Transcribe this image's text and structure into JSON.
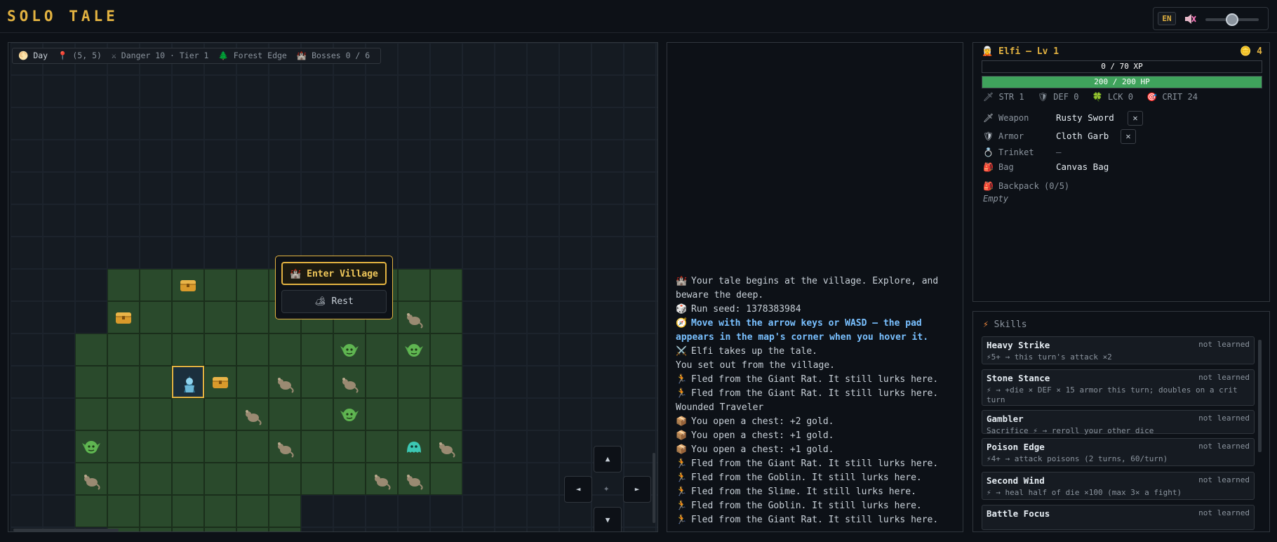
{
  "app": {
    "title": "SOLO TALE",
    "language": "EN",
    "volume": 0.45
  },
  "map": {
    "status": {
      "time": "Day",
      "position": "(5, 5)",
      "danger": "Danger 10 · Tier 1",
      "zone": "Forest Edge",
      "bosses": "Bosses 0 / 6"
    },
    "popup": {
      "enter_label": "Enter Village",
      "rest_label": "Rest"
    },
    "dpad": {
      "up": "▲",
      "down": "▼",
      "left": "◄",
      "right": "►",
      "center": "✦"
    }
  },
  "log": [
    {
      "icon": "🏰",
      "text": "Your tale begins at the village. Explore, and beware the deep.",
      "style": "normal"
    },
    {
      "icon": "🎲",
      "text": "Run seed: 1378383984",
      "style": "normal"
    },
    {
      "icon": "🧭",
      "text": "Move with the arrow keys or WASD — the pad appears in the map's corner when you hover it.",
      "style": "hint"
    },
    {
      "icon": "⚔️",
      "text": "Elfi takes up the tale.",
      "style": "normal"
    },
    {
      "icon": "",
      "text": "You set out from the village.",
      "style": "normal"
    },
    {
      "icon": "🏃",
      "text": "Fled from the Giant Rat. It still lurks here.",
      "style": "normal"
    },
    {
      "icon": "🏃",
      "text": "Fled from the Giant Rat. It still lurks here.",
      "style": "normal"
    },
    {
      "icon": "",
      "text": "Wounded Traveler",
      "style": "normal"
    },
    {
      "icon": "📦",
      "text": "You open a chest: +2 gold.",
      "style": "normal"
    },
    {
      "icon": "📦",
      "text": "You open a chest: +1 gold.",
      "style": "normal"
    },
    {
      "icon": "📦",
      "text": "You open a chest: +1 gold.",
      "style": "normal"
    },
    {
      "icon": "🏃",
      "text": "Fled from the Giant Rat. It still lurks here.",
      "style": "normal"
    },
    {
      "icon": "🏃",
      "text": "Fled from the Goblin. It still lurks here.",
      "style": "normal"
    },
    {
      "icon": "🏃",
      "text": "Fled from the Slime. It still lurks here.",
      "style": "normal"
    },
    {
      "icon": "🏃",
      "text": "Fled from the Goblin. It still lurks here.",
      "style": "normal"
    },
    {
      "icon": "🏃",
      "text": "Fled from the Giant Rat. It still lurks here.",
      "style": "normal"
    }
  ],
  "hero": {
    "name": "Elfi — Lv 1",
    "gold": "4",
    "xp_text": "0 / 70 XP",
    "xp_fraction": 0,
    "hp_text": "200 / 200 HP",
    "hp_fraction": 1,
    "stats": {
      "str": "STR 1",
      "def": "DEF 0",
      "lck": "LCK 0",
      "crit": "CRIT 24"
    },
    "equipment": {
      "weapon_label": "Weapon",
      "weapon_value": "Rusty Sword",
      "armor_label": "Armor",
      "armor_value": "Cloth Garb",
      "trinket_label": "Trinket",
      "trinket_value": "—",
      "bag_label": "Bag",
      "bag_value": "Canvas Bag",
      "remove_glyph": "✕"
    },
    "backpack_label": "Backpack (0/5)",
    "backpack_empty": "Empty"
  },
  "skills": {
    "title": "Skills",
    "items": [
      {
        "name": "Heavy Strike",
        "state": "not learned",
        "desc": "⚡5+ → this turn's attack ×2"
      },
      {
        "name": "Stone Stance",
        "state": "not learned",
        "desc": "⚡ → +die × DEF × 15 armor this turn; doubles on a crit turn"
      },
      {
        "name": "Gambler",
        "state": "not learned",
        "desc": "Sacrifice ⚡ → reroll your other dice"
      },
      {
        "name": "Poison Edge",
        "state": "not learned",
        "desc": "⚡4+ → attack poisons (2 turns, 60/turn)"
      },
      {
        "name": "Second Wind",
        "state": "not learned",
        "desc": "⚡ → heal half of die ×100 (max 3× a fight)"
      },
      {
        "name": "Battle Focus",
        "state": "not learned",
        "desc": ""
      }
    ]
  }
}
